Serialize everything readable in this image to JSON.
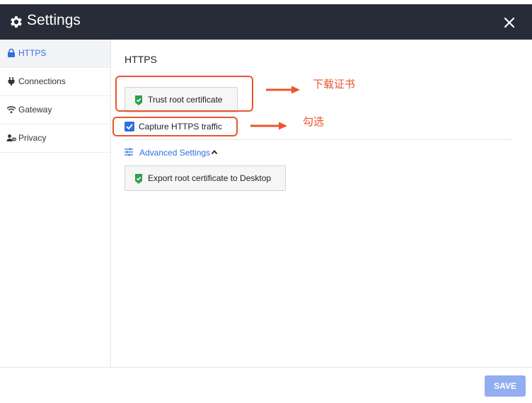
{
  "window": {
    "title": "Settings",
    "close_icon": "close-icon",
    "gear_icon": "gear-icon"
  },
  "sidebar": {
    "items": [
      {
        "label": "HTTPS",
        "icon": "lock-icon",
        "active": true
      },
      {
        "label": "Connections",
        "icon": "plug-icon",
        "active": false
      },
      {
        "label": "Gateway",
        "icon": "wifi-icon",
        "active": false
      },
      {
        "label": "Privacy",
        "icon": "user-eye-icon",
        "active": false
      }
    ]
  },
  "main": {
    "title": "HTTPS",
    "trust_button": "Trust root certificate",
    "capture_label": "Capture HTTPS traffic",
    "capture_checked": true,
    "advanced_label": "Advanced Settings",
    "export_button": "Export root certificate to Desktop"
  },
  "annotations": {
    "download": "下载证书",
    "check": "勾选"
  },
  "footer": {
    "save_label": "SAVE"
  },
  "colors": {
    "titlebar": "#272c38",
    "accent": "#2f6fe0",
    "annotation": "#e8572b",
    "save_disabled": "#93aef0"
  }
}
